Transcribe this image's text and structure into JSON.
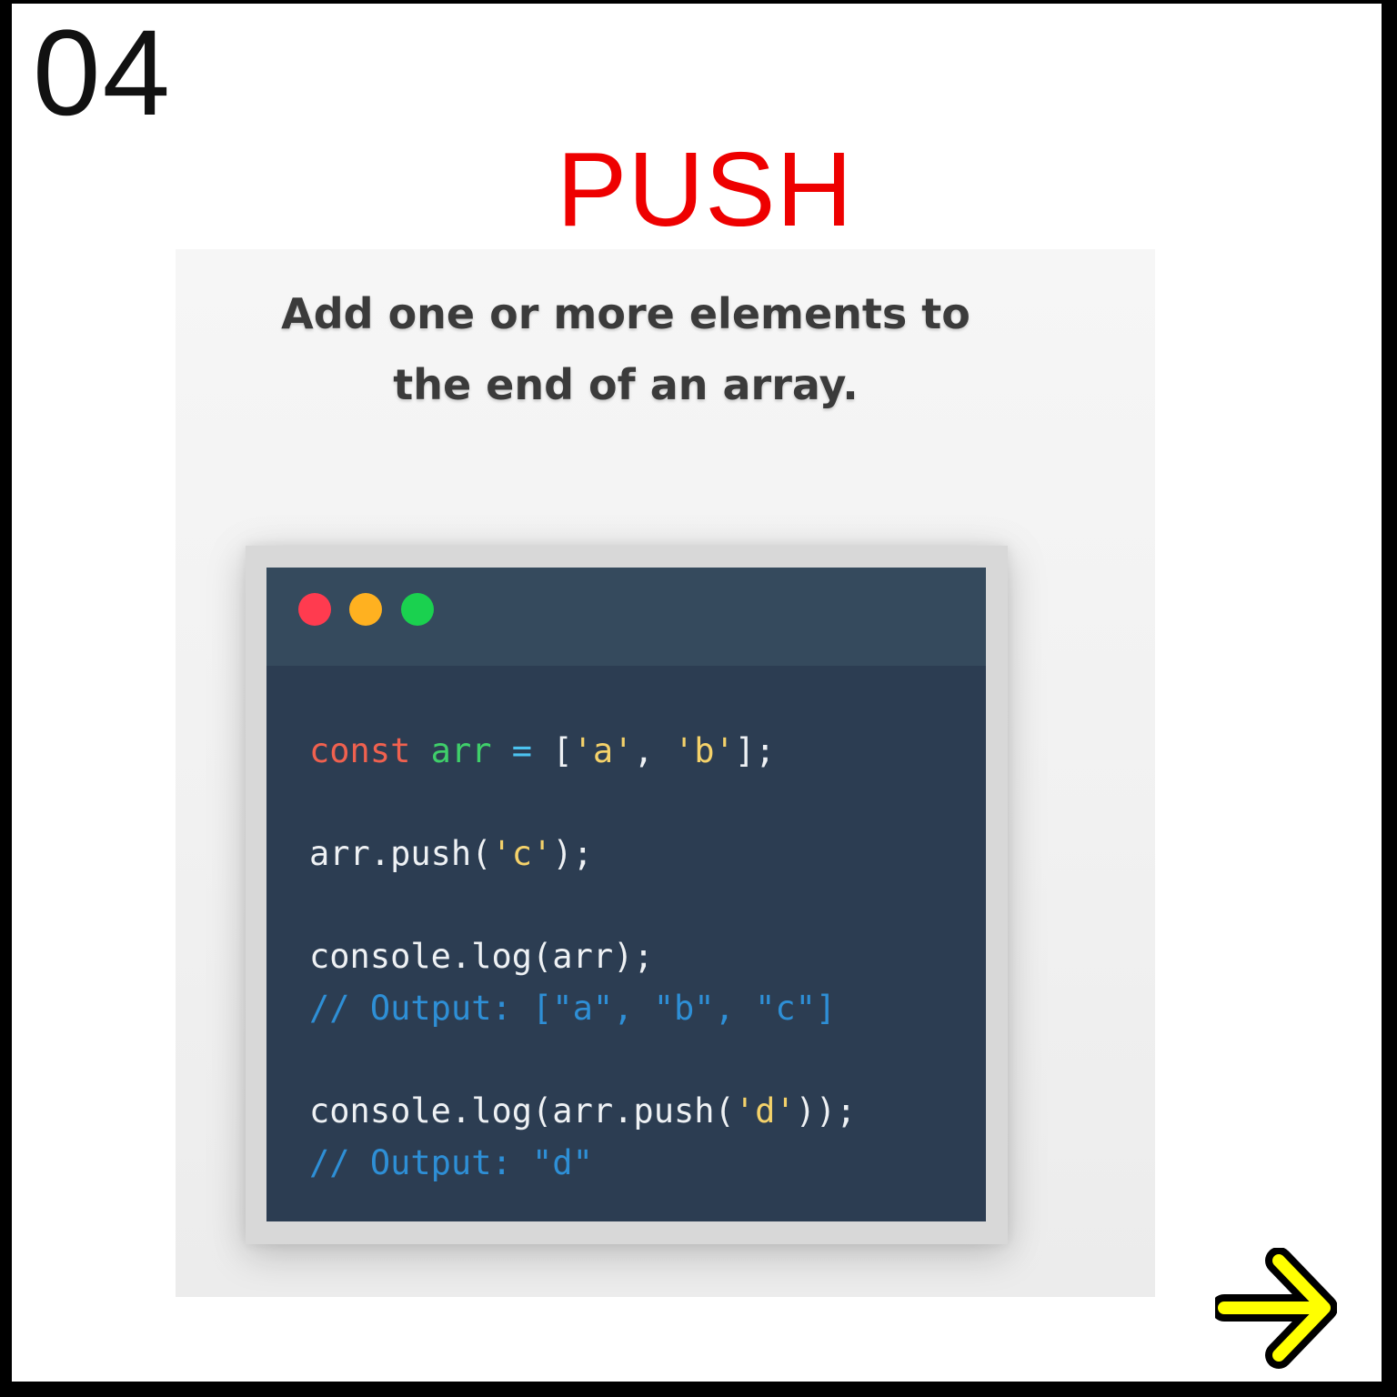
{
  "slide": {
    "number": "04",
    "title": "PUSH",
    "description_line1": "Add one or more elements to",
    "description_line2": "the end of an array."
  },
  "colors": {
    "title": "#ee0000",
    "code_background": "#2c3d52",
    "title_bar": "#354a5d",
    "dot_red": "#ff3b4f",
    "dot_yellow": "#ffb120",
    "dot_green": "#1ad14f",
    "keyword": "#f0614f",
    "variable": "#3fcf6a",
    "operator": "#4cc3f0",
    "string": "#f5d26a",
    "comment": "#2e8fd6",
    "arrow": "#ffff00"
  },
  "code": {
    "line1": {
      "keyword": "const",
      "variable": "arr",
      "operator": "=",
      "open": "[",
      "str_a": "'a'",
      "comma": ", ",
      "str_b": "'b'",
      "close": "];"
    },
    "line2": {
      "call": "arr.push(",
      "str_c": "'c'",
      "close": ");"
    },
    "line3": "console.log(arr);",
    "line4": "// Output: [\"a\", \"b\", \"c\"]",
    "line5": {
      "call": "console.log(arr.push(",
      "str_d": "'d'",
      "close": "));"
    },
    "line6": "// Output: \"d\""
  },
  "icons": {
    "next": "arrow-right-icon",
    "window_controls": [
      "close-dot-icon",
      "minimize-dot-icon",
      "maximize-dot-icon"
    ]
  }
}
